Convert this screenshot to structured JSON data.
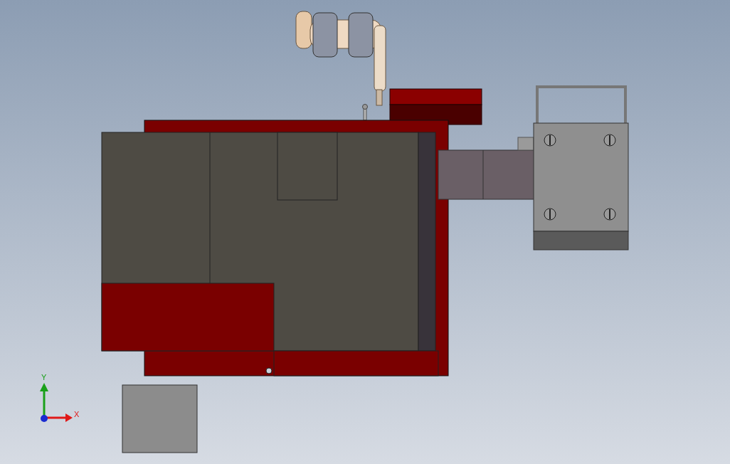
{
  "viewport": {
    "triad_axes": [
      {
        "kind": "y",
        "label": "Y"
      },
      {
        "kind": "x",
        "label": "X"
      }
    ]
  }
}
